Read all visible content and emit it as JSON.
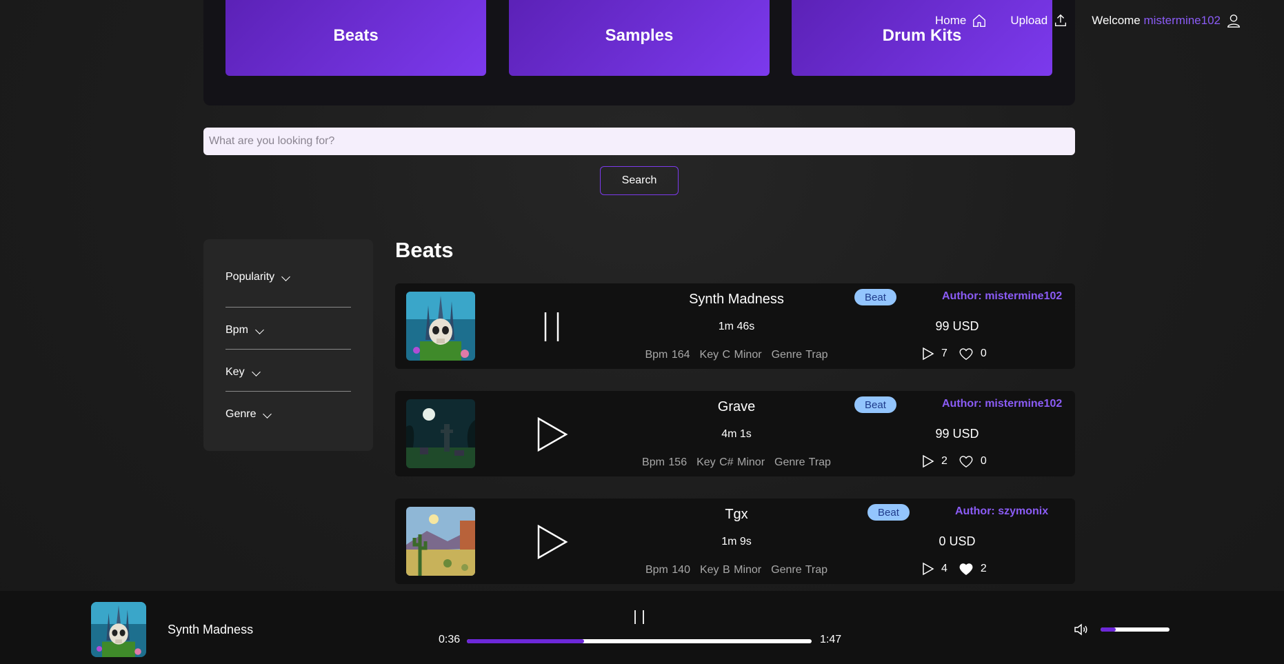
{
  "nav": {
    "home_label": "Home",
    "upload_label": "Upload",
    "welcome_label": "Welcome",
    "username": "mistermine102"
  },
  "categories": [
    {
      "label": "Beats"
    },
    {
      "label": "Samples"
    },
    {
      "label": "Drum Kits"
    }
  ],
  "search": {
    "placeholder": "What are you looking for?",
    "value": "",
    "button_label": "Search"
  },
  "filters": [
    {
      "label": "Popularity"
    },
    {
      "label": "Bpm"
    },
    {
      "label": "Key"
    },
    {
      "label": "Genre"
    }
  ],
  "section_title": "Beats",
  "beats": [
    {
      "title": "Synth Madness",
      "duration": "1m 46s",
      "bpm": "Bpm 164",
      "key": "Key C Minor",
      "genre": "Genre Trap",
      "badge": "Beat",
      "author": "Author: mistermine102",
      "price": "99 USD",
      "plays": "7",
      "likes": "0",
      "liked": false,
      "playing": true,
      "art": "skull-castle"
    },
    {
      "title": "Grave",
      "duration": "4m 1s",
      "bpm": "Bpm 156",
      "key": "Key C# Minor",
      "genre": "Genre Trap",
      "badge": "Beat",
      "author": "Author: mistermine102",
      "price": "99 USD",
      "plays": "2",
      "likes": "0",
      "liked": false,
      "playing": false,
      "art": "graveyard-moon"
    },
    {
      "title": "Tgx",
      "duration": "1m 9s",
      "bpm": "Bpm 140",
      "key": "Key B Minor",
      "genre": "Genre Trap",
      "badge": "Beat",
      "author": "Author: szymonix",
      "price": "0 USD",
      "plays": "4",
      "likes": "2",
      "liked": true,
      "playing": false,
      "art": "desert-cactus"
    }
  ],
  "player": {
    "title": "Synth Madness",
    "current_time": "0:36",
    "total_time": "1:47",
    "progress": 0.34,
    "volume": 0.22
  },
  "colors": {
    "accent": "#7c3aed",
    "author": "#8b5cf6",
    "badge_bg": "#93c5fd",
    "badge_text": "#1e3a8a"
  }
}
